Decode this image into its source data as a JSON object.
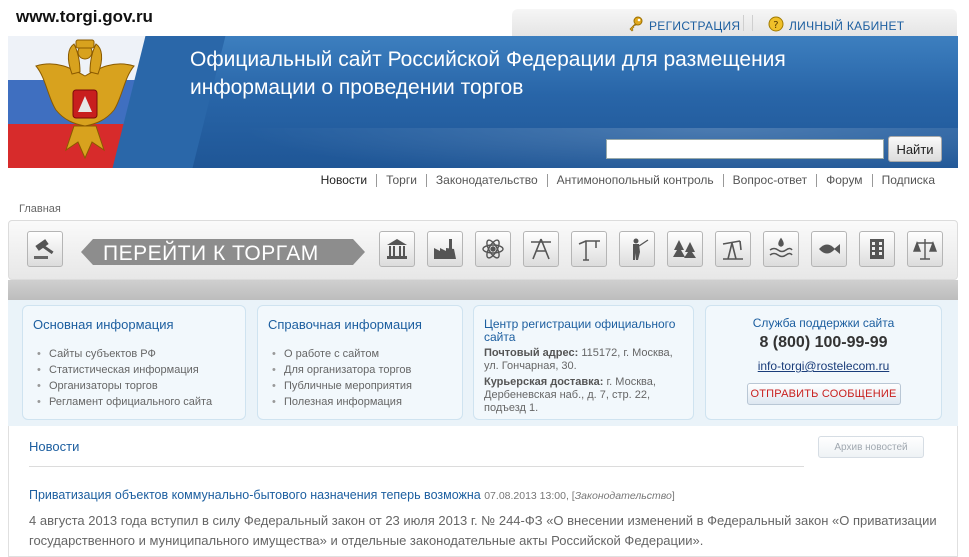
{
  "url_label": "www.torgi.gov.ru",
  "topbar": {
    "register": "РЕГИСТРАЦИЯ",
    "cabinet": "ЛИЧНЫЙ КАБИНЕТ"
  },
  "banner": {
    "title": "Официальный сайт Российской Федерации для размещения информации о проведении торгов",
    "search_value": "",
    "search_button": "Найти"
  },
  "nav": [
    "Новости",
    "Торги",
    "Законодательство",
    "Антимонопольный контроль",
    "Вопрос-ответ",
    "Форум",
    "Подписка"
  ],
  "breadcrumb": "Главная",
  "goto_label": "ПЕРЕЙТИ К ТОРГАМ",
  "categories": [
    "building-icon",
    "factory-icon",
    "atom-icon",
    "oil-rig-icon",
    "crane-icon",
    "hunter-icon",
    "forest-icon",
    "oil-pump-icon",
    "water-icon",
    "fish-icon",
    "office-icon",
    "scales-icon"
  ],
  "cards": {
    "main_info": {
      "title": "Основная информация",
      "items": [
        "Сайты субъектов РФ",
        "Статистическая информация",
        "Организаторы торгов",
        "Регламент официального сайта"
      ]
    },
    "reference": {
      "title": "Справочная информация",
      "items": [
        "О работе с сайтом",
        "Для организатора торгов",
        "Публичные мероприятия",
        "Полезная информация"
      ]
    },
    "registration": {
      "title": "Центр регистрации официального сайта",
      "postal_label": "Почтовый адрес:",
      "postal_value": "115172, г. Москва, ул. Гончарная, 30.",
      "courier_label": "Курьерская доставка:",
      "courier_value": "г. Москва, Дербеневская наб., д. 7, стр. 22, подъезд 1."
    },
    "support": {
      "title": "Служба поддержки сайта",
      "phone": "8 (800) 100-99-99",
      "email": "info-torgi@rostelecom.ru",
      "button": "ОТПРАВИТЬ СООБЩЕНИЕ"
    }
  },
  "news": {
    "title": "Новости",
    "archive_button": "Архив новостей",
    "item": {
      "headline": "Приватизация объектов коммунально-бытового назначения теперь возможна",
      "date": "07.08.2013 13:00,",
      "category": "Законодательство",
      "body": "4 августа 2013 года вступил в силу Федеральный закон от 23 июля 2013 г. № 244-ФЗ «О внесении изменений в Федеральный закон «О приватизации государственного и муниципального имущества» и отдельные законодательные акты Российской Федерации»."
    }
  }
}
